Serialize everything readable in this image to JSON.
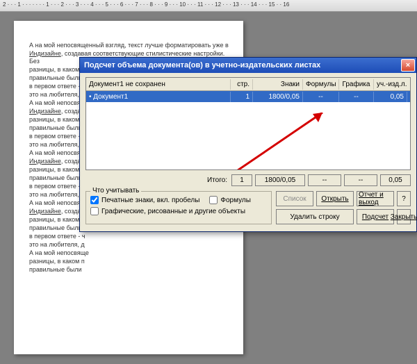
{
  "ruler": {
    "marks": [
      "2",
      "1",
      "",
      "1",
      "2",
      "3",
      "4",
      "5",
      "6",
      "7",
      "8",
      "9",
      "10",
      "11",
      "12",
      "13",
      "14",
      "15",
      "16"
    ]
  },
  "page_text_sample": "А на мой непосвященный взгляд, текст лучше форматировать уже в Индизайне, создавая ...",
  "dialog": {
    "title": "Подсчет объема документа(ов) в учетно-издательских листах",
    "close_label": "×",
    "columns": {
      "doc": "Документ1 не сохранен",
      "str": "стр.",
      "zn": "Знаки",
      "frm": "Формулы",
      "grf": "Графика",
      "uch": "уч.-изд.л."
    },
    "row": {
      "doc": "• Документ1",
      "str": "1",
      "zn": "1800/0,05",
      "frm": "--",
      "grf": "--",
      "uch": "0,05"
    },
    "totals": {
      "label": "Итого:",
      "str": "1",
      "zn": "1800/0,05",
      "frm": "--",
      "grf": "--",
      "uch": "0,05"
    },
    "fieldset": {
      "legend": "Что учитывать",
      "chk_chars": "Печатные знаки, вкл. пробелы",
      "chk_formulas": "Формулы",
      "chk_graphics": "Графические, рисованные и другие объекты",
      "chk_chars_on": true,
      "chk_formulas_on": false,
      "chk_graphics_on": false
    },
    "buttons": {
      "list": "Список",
      "open": "Открыть",
      "report_exit": "Отчет и выход",
      "help": "?",
      "delete_row": "Удалить строку",
      "count": "Подсчет",
      "close": "Закрыть"
    }
  }
}
